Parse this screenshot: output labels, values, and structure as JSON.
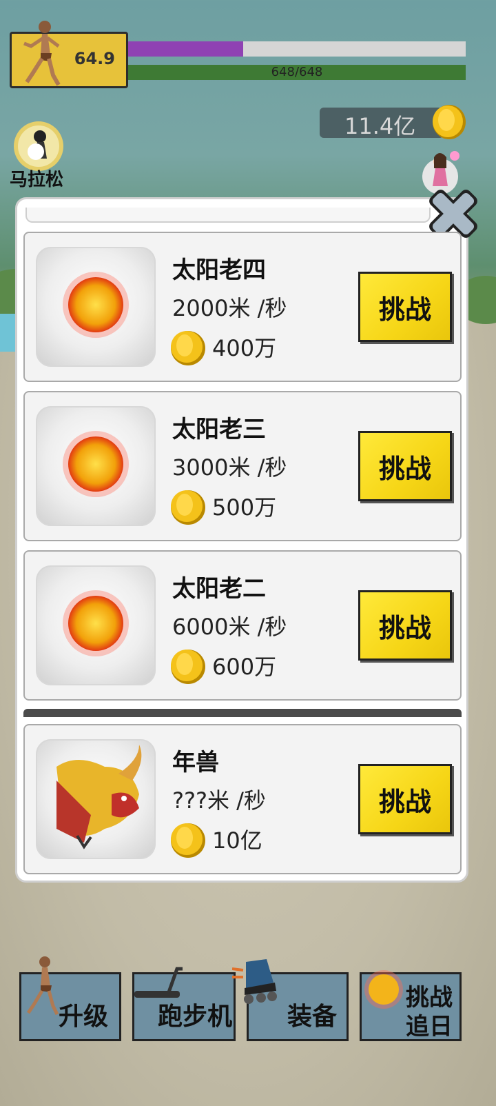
{
  "hud": {
    "score": "64.9",
    "progress": 0.34,
    "hp_text": "648/648",
    "coins": "11.4亿",
    "marathon_label": "马拉松"
  },
  "challenge_list": [
    {
      "name": "太阳老四",
      "speed": "2000米 /秒",
      "price": "400万",
      "button": "挑战",
      "icon": "sun-icon"
    },
    {
      "name": "太阳老三",
      "speed": "3000米 /秒",
      "price": "500万",
      "button": "挑战",
      "icon": "sun-icon"
    },
    {
      "name": "太阳老二",
      "speed": "6000米 /秒",
      "price": "600万",
      "button": "挑战",
      "icon": "sun-icon"
    },
    {
      "name": "年兽",
      "speed": "???米 /秒",
      "price": "10亿",
      "button": "挑战",
      "icon": "nian-beast-icon"
    }
  ],
  "bottom_menu": {
    "upgrade": "升级",
    "treadmill": "跑步机",
    "equipment": "装备",
    "chase_1": "挑战",
    "chase_2": "追日"
  },
  "colors": {
    "button_yellow": "#f6d617",
    "progress_purple": "#8f42b3",
    "hp_green": "#3e7a34",
    "menu_blue": "#6f90a2"
  }
}
